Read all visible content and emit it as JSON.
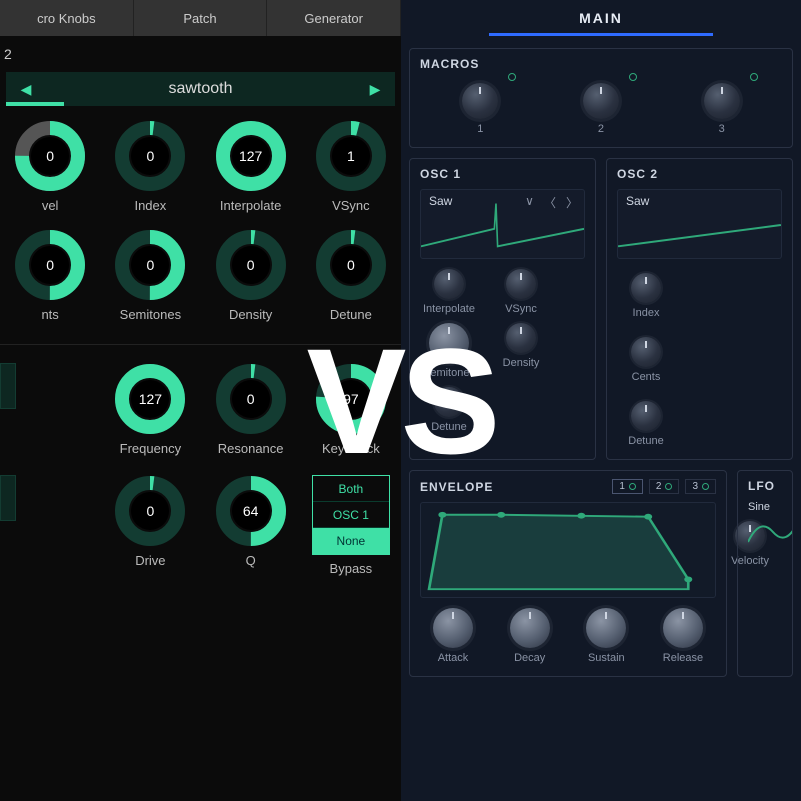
{
  "left": {
    "tabs": [
      "cro Knobs",
      "Patch",
      "Generator"
    ],
    "osc_title": "2",
    "wave_bar": {
      "label": "sawtooth",
      "prev_glyph": "◀",
      "next_glyph": "▶"
    },
    "row1": [
      {
        "label": "vel",
        "value": "0",
        "fill": 0.75,
        "grey": true
      },
      {
        "label": "Index",
        "value": "0",
        "fill": 0.02
      },
      {
        "label": "Interpolate",
        "value": "127",
        "fill": 1.0
      },
      {
        "label": "VSync",
        "value": "1",
        "fill": 0.04
      }
    ],
    "row2": [
      {
        "label": "nts",
        "value": "0",
        "fill": 0.5
      },
      {
        "label": "Semitones",
        "value": "0",
        "fill": 0.5
      },
      {
        "label": "Density",
        "value": "0",
        "fill": 0.02
      },
      {
        "label": "Detune",
        "value": "0",
        "fill": 0.02
      }
    ],
    "row3": [
      {
        "stub": true
      },
      {
        "label": "Frequency",
        "value": "127",
        "fill": 1.0
      },
      {
        "label": "Resonance",
        "value": "0",
        "fill": 0.02
      },
      {
        "label": "Key Track",
        "value": "97",
        "fill": 0.76
      }
    ],
    "row4": [
      {
        "stub": true
      },
      {
        "label": "Drive",
        "value": "0",
        "fill": 0.02
      },
      {
        "label": "Q",
        "value": "64",
        "fill": 0.5
      },
      {
        "label": "Bypass",
        "bypass": true
      }
    ],
    "bypass": {
      "options": [
        "Both",
        "OSC 1",
        "None"
      ],
      "selected": 2
    }
  },
  "right": {
    "main_tab": "MAIN",
    "macros": {
      "title": "MACROS",
      "items": [
        "1",
        "2",
        "3"
      ]
    },
    "osc1": {
      "title": "OSC 1",
      "wave": "Saw",
      "row1": [
        "Interpolate",
        "VSync"
      ],
      "row2": [
        "Semitones",
        "Density"
      ],
      "row3": [
        "Detune"
      ]
    },
    "osc2": {
      "title": "OSC 2",
      "wave": "Saw",
      "labels": [
        "Index",
        "Cents",
        "Detune"
      ]
    },
    "envelope": {
      "title": "ENVELOPE",
      "tabs": [
        "1",
        "2",
        "3"
      ],
      "velocity_label": "Velocity",
      "knobs": [
        "Attack",
        "Decay",
        "Sustain",
        "Release"
      ]
    },
    "lfo": {
      "title": "LFO",
      "wave_hint": "Sine"
    }
  },
  "vs_text": "VS"
}
